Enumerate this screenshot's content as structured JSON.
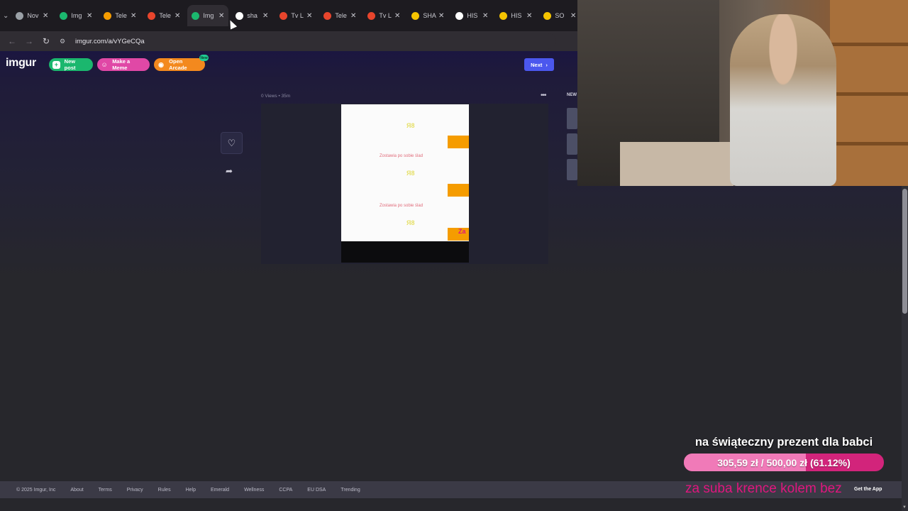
{
  "browser": {
    "tabs": [
      {
        "label": "Nov",
        "favicon_color": "#9aa0a6",
        "icon": "chrome-icon",
        "active": false
      },
      {
        "label": "Img",
        "favicon_color": "#1bb76e",
        "icon": "imgur-icon",
        "active": false
      },
      {
        "label": "Tele",
        "favicon_color": "#f59c00",
        "icon": "e-icon",
        "active": false
      },
      {
        "label": "Tele",
        "favicon_color": "#e8452c",
        "icon": "c-icon",
        "active": false
      },
      {
        "label": "Img",
        "favicon_color": "#1bb76e",
        "icon": "imgur-icon",
        "active": true
      },
      {
        "label": "sha",
        "favicon_color": "#ffffff",
        "icon": "google-icon",
        "active": false
      },
      {
        "label": "Tv L",
        "favicon_color": "#e8452c",
        "icon": "a-icon",
        "active": false
      },
      {
        "label": "Tele",
        "favicon_color": "#e8452c",
        "icon": "a-icon",
        "active": false
      },
      {
        "label": "Tv L",
        "favicon_color": "#e8452c",
        "icon": "a-icon",
        "active": false
      },
      {
        "label": "SHA",
        "favicon_color": "#f5c400",
        "icon": "play-icon",
        "active": false
      },
      {
        "label": "HIS",
        "favicon_color": "#ffffff",
        "icon": "google-icon",
        "active": false
      },
      {
        "label": "HIS",
        "favicon_color": "#f5c400",
        "icon": "play-icon",
        "active": false
      },
      {
        "label": "SO",
        "favicon_color": "#f5c400",
        "icon": "play-icon",
        "active": false
      }
    ],
    "url": "imgur.com/a/vYGeCQa"
  },
  "imgur": {
    "logo": "imgur",
    "new_post": "New post",
    "make_meme": "Make a Meme",
    "open_arcade": "Open Arcade",
    "arcade_badge": "New",
    "next": "Next",
    "views": "0 Views • 35m",
    "newest_label": "NEW",
    "image_text_1": "Zostawia po sobie ślad",
    "image_text_2": "Zostawia po sobie ślad",
    "image_tag": "Za"
  },
  "footer": {
    "copyright": "© 2025 Imgur, Inc",
    "links": [
      "About",
      "Terms",
      "Privacy",
      "Rules",
      "Help",
      "Emerald",
      "Wellness",
      "CCPA",
      "EU DSA",
      "Trending"
    ],
    "get_app": "Get the App"
  },
  "stream": {
    "donation_title": "na świąteczny prezent dla babci",
    "donation_text": "305,59 zł / 500,00 zł (61.12%)",
    "donation_fraction": 0.6112,
    "ticker": "za suba krence kolem bez"
  }
}
